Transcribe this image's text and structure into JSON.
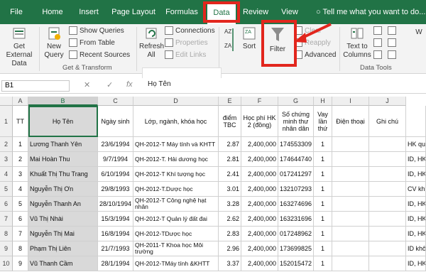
{
  "tabs": [
    "File",
    "Home",
    "Insert",
    "Page Layout",
    "Formulas",
    "Data",
    "Review",
    "View"
  ],
  "active_tab": "Data",
  "tell_me": "Tell me what you want to do...",
  "ribbon": {
    "get_external": "Get External Data",
    "new_query": "New Query",
    "show_queries": "Show Queries",
    "from_table": "From Table",
    "recent_sources": "Recent Sources",
    "group_get_transform": "Get & Transform",
    "refresh_all": "Refresh All",
    "connections": "Connections",
    "properties": "Properties",
    "edit_links": "Edit Links",
    "sort": "Sort",
    "filter": "Filter",
    "clear": "Clear",
    "reapply": "Reapply",
    "advanced": "Advanced",
    "text_to_columns": "Text to Columns",
    "group_data_tools": "Data Tools",
    "what_if": "W"
  },
  "formula_bar": {
    "name_box": "B1",
    "value": "Họ Tên"
  },
  "columns": [
    "A",
    "B",
    "C",
    "D",
    "E",
    "F",
    "G",
    "H",
    "I",
    "J"
  ],
  "headers": [
    "TT",
    "Họ Tên",
    "Ngày sinh",
    "Lớp, ngành, khóa học",
    "điểm TBC",
    "Học phí HK 2 (đồng)",
    "Số chứng minh thư nhân dân",
    "Vay lần thứ",
    "Điện thoại",
    "Ghi chú",
    ""
  ],
  "rows": [
    {
      "n": "2",
      "tt": "1",
      "name": "Lương Thanh Yên",
      "dob": "23/6/1994",
      "cls": "QH-2012-T Máy tính và KHTT",
      "gpa": "2.87",
      "fee": "2,400,000",
      "id": "174553309",
      "loan": "1",
      "extra": "HK qu"
    },
    {
      "n": "3",
      "tt": "2",
      "name": "Mai Hoàn Thu",
      "dob": "9/7/1994",
      "cls": "QH-2012-T. Hải dương học",
      "gpa": "2.81",
      "fee": "2,400,000",
      "id": "174644740",
      "loan": "1",
      "extra": "ID, HK"
    },
    {
      "n": "4",
      "tt": "3",
      "name": "Khuất Thị Thu Trang",
      "dob": "6/10/1994",
      "cls": "QH-2012-T Khí tượng học",
      "gpa": "2.41",
      "fee": "2,400,000",
      "id": "017241297",
      "loan": "1",
      "extra": "ID, HK"
    },
    {
      "n": "5",
      "tt": "4",
      "name": "Nguyễn Thị Ơn",
      "dob": "29/8/1993",
      "cls": "QH-2012-T.Dược học",
      "gpa": "3.01",
      "fee": "2,400,000",
      "id": "132107293",
      "loan": "1",
      "extra": "CV kh"
    },
    {
      "n": "6",
      "tt": "5",
      "name": "Nguyễn Thanh An",
      "dob": "28/10/1994",
      "cls": "QH-2012-T Công nghệ hạt nhân",
      "gpa": "3.28",
      "fee": "2,400,000",
      "id": "163274696",
      "loan": "1",
      "extra": "ID, HK"
    },
    {
      "n": "7",
      "tt": "6",
      "name": "Vũ Thị Nhài",
      "dob": "15/3/1994",
      "cls": "QH-2012-T Quản lý đất đai",
      "gpa": "2.62",
      "fee": "2,400,000",
      "id": "163231696",
      "loan": "1",
      "extra": "ID, HK"
    },
    {
      "n": "8",
      "tt": "7",
      "name": "Nguyễn Thị Mai",
      "dob": "16/8/1994",
      "cls": "QH-2012-TDược học",
      "gpa": "2.83",
      "fee": "2,400,000",
      "id": "017248962",
      "loan": "1",
      "extra": "ID, HK"
    },
    {
      "n": "9",
      "tt": "8",
      "name": "Phạm Thị Liên",
      "dob": "21/7/1993",
      "cls": "QH-2011-T Khoa học Môi trường",
      "gpa": "2.96",
      "fee": "2,400,000",
      "id": "173699825",
      "loan": "1",
      "extra": "ID khô"
    },
    {
      "n": "10",
      "tt": "9",
      "name": "Vũ Thanh Cầm",
      "dob": "28/1/1994",
      "cls": "QH-2012-TMáy tính &KHTT",
      "gpa": "3.37",
      "fee": "2,400,000",
      "id": "152015472",
      "loan": "1",
      "extra": "ID, HK"
    }
  ],
  "accent": "#217346",
  "highlight": "#e2261d"
}
